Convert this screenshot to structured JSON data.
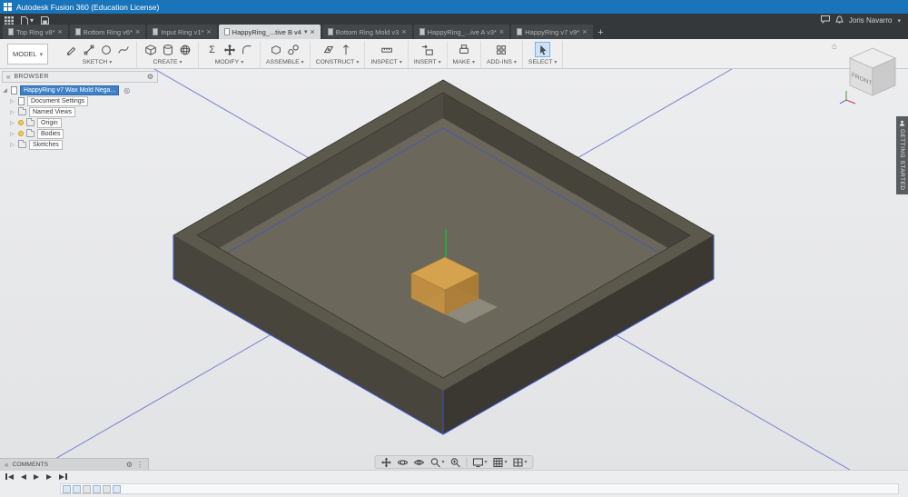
{
  "titlebar": {
    "title": "Autodesk Fusion 360 (Education License)"
  },
  "appbar": {
    "user_name": "Joris Navarro"
  },
  "icons": {
    "caret_down": "▾",
    "close": "×",
    "plus": "+",
    "gear": "⚙",
    "collapse": "«",
    "root_expanded": "◢",
    "expand": "▷",
    "home": "⌂",
    "target": "◎",
    "sigma": "Σ",
    "dots": "⋮"
  },
  "tabs": {
    "items": [
      {
        "label": "Top Ring v8*"
      },
      {
        "label": "Bottom Ring v6*"
      },
      {
        "label": "Input Ring v1*"
      },
      {
        "label": "HappyRing_...tive B v4"
      },
      {
        "label": "Bottom Ring Mold v3"
      },
      {
        "label": "HappyRing_...ive A v3*"
      },
      {
        "label": "HappyRing v7 v9*"
      }
    ]
  },
  "toolbar": {
    "workspace_label": "MODEL",
    "groups": [
      {
        "label": "SKETCH"
      },
      {
        "label": "CREATE"
      },
      {
        "label": "MODIFY"
      },
      {
        "label": "ASSEMBLE"
      },
      {
        "label": "CONSTRUCT"
      },
      {
        "label": "INSPECT"
      },
      {
        "label": "INSERT"
      },
      {
        "label": "MAKE"
      },
      {
        "label": "ADD-INS"
      },
      {
        "label": "SELECT"
      }
    ]
  },
  "browser": {
    "header": "BROWSER",
    "root_label": "HappyRing v7 Wax Mold Nega...",
    "items": [
      {
        "label": "Document Settings"
      },
      {
        "label": "Named Views"
      },
      {
        "label": "Origin"
      },
      {
        "label": "Bodies"
      },
      {
        "label": "Sketches"
      }
    ]
  },
  "viewcube": {
    "front_label": "FRONT"
  },
  "right_panel": {
    "label": "GETTING STARTED"
  },
  "comments": {
    "label": "COMMENTS"
  },
  "colors": {
    "titlebar_blue": "#1974BA",
    "selection_blue": "#3E80C6",
    "model_rim": "#5B584C",
    "model_floor": "#6B675A",
    "cube_orange": "#DFA94E",
    "axis_green": "#2FA43C",
    "sketch_line_blue": "#5560CC"
  }
}
